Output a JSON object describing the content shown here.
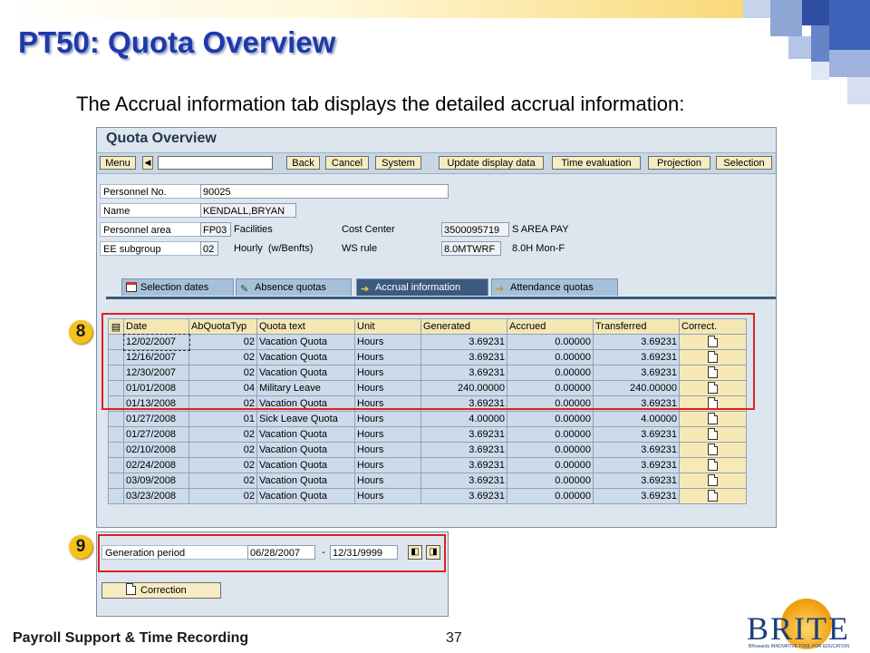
{
  "slide": {
    "title": "PT50: Quota Overview",
    "subtitle": "The Accrual information tab displays the detailed accrual information:",
    "footer": "Payroll Support & Time Recording",
    "page_number": "37"
  },
  "sap": {
    "window_title": "Quota Overview",
    "toolbar": {
      "menu": "Menu",
      "command_value": "",
      "back": "Back",
      "cancel": "Cancel",
      "system": "System",
      "update": "Update display data",
      "time_eval": "Time evaluation",
      "projection": "Projection",
      "selection": "Selection"
    },
    "header": {
      "personnel_no_label": "Personnel No.",
      "personnel_no": "90025",
      "name_label": "Name",
      "name": "KENDALL,BRYAN",
      "personnel_area_label": "Personnel area",
      "personnel_area_code": "FP03",
      "personnel_area_text": "Facilities",
      "cost_center_label": "Cost Center",
      "cost_center": "3500095719",
      "cost_center_text": "S AREA PAY",
      "ee_subgroup_label": "EE subgroup",
      "ee_subgroup_code": "02",
      "ee_subgroup_text": "Hourly  (w/Benfts)",
      "ws_rule_label": "WS rule",
      "ws_rule": "8.0MTWRF",
      "ws_rule_text": "8.0H Mon-F"
    },
    "tabs": [
      "Selection dates",
      "Absence quotas",
      "Accrual information",
      "Attendance quotas"
    ],
    "active_tab": "Accrual information",
    "columns": [
      "Date",
      "AbQuotaTyp",
      "Quota text",
      "Unit",
      "Generated",
      "Accrued",
      "Transferred",
      "Correct."
    ],
    "rows": [
      [
        "12/02/2007",
        "02",
        "Vacation Quota",
        "Hours",
        "3.69231",
        "0.00000",
        "3.69231"
      ],
      [
        "12/16/2007",
        "02",
        "Vacation Quota",
        "Hours",
        "3.69231",
        "0.00000",
        "3.69231"
      ],
      [
        "12/30/2007",
        "02",
        "Vacation Quota",
        "Hours",
        "3.69231",
        "0.00000",
        "3.69231"
      ],
      [
        "01/01/2008",
        "04",
        "Military Leave",
        "Hours",
        "240.00000",
        "0.00000",
        "240.00000"
      ],
      [
        "01/13/2008",
        "02",
        "Vacation Quota",
        "Hours",
        "3.69231",
        "0.00000",
        "3.69231"
      ],
      [
        "01/27/2008",
        "01",
        "Sick Leave Quota",
        "Hours",
        "4.00000",
        "0.00000",
        "4.00000"
      ],
      [
        "01/27/2008",
        "02",
        "Vacation Quota",
        "Hours",
        "3.69231",
        "0.00000",
        "3.69231"
      ],
      [
        "02/10/2008",
        "02",
        "Vacation Quota",
        "Hours",
        "3.69231",
        "0.00000",
        "3.69231"
      ],
      [
        "02/24/2008",
        "02",
        "Vacation Quota",
        "Hours",
        "3.69231",
        "0.00000",
        "3.69231"
      ],
      [
        "03/09/2008",
        "02",
        "Vacation Quota",
        "Hours",
        "3.69231",
        "0.00000",
        "3.69231"
      ],
      [
        "03/23/2008",
        "02",
        "Vacation Quota",
        "Hours",
        "3.69231",
        "0.00000",
        "3.69231"
      ]
    ],
    "generation_period": {
      "label": "Generation period",
      "from": "06/28/2007",
      "separator": "-",
      "to": "12/31/9999"
    },
    "correction_button": "Correction"
  },
  "callouts": {
    "first": "8",
    "second": "9"
  },
  "logo": {
    "text": "BRITE",
    "tagline": "BRowards INNOVATIVE TOOL FOR EDUCATION"
  },
  "colors": {
    "title": "#1f3aa8",
    "highlight": "#e02020",
    "badge": "#f6c21a",
    "active_tab": "#3b5a7e"
  }
}
